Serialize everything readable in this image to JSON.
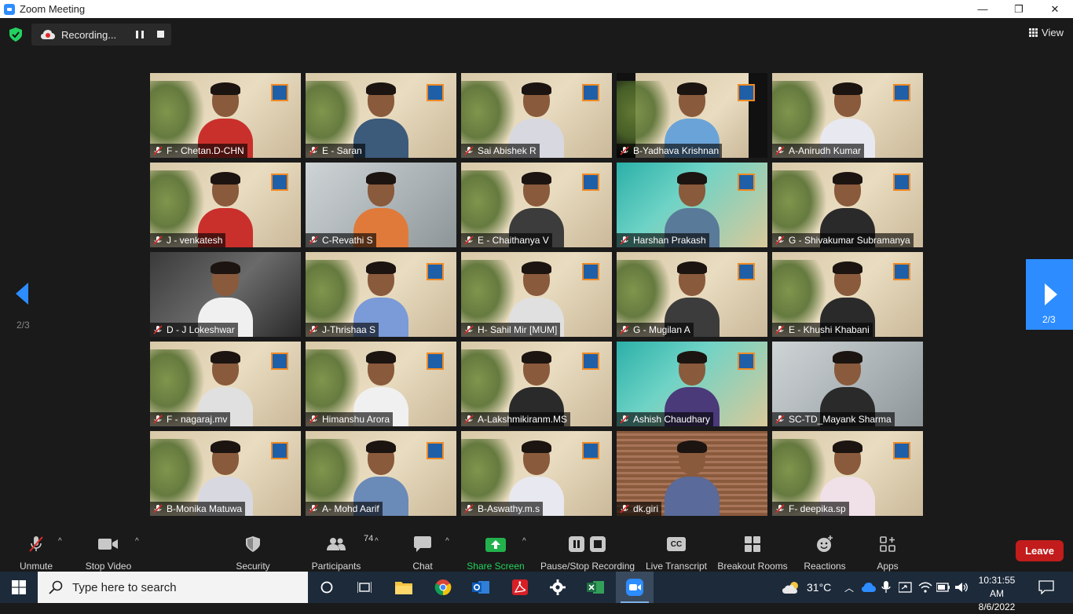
{
  "window": {
    "title": "Zoom Meeting",
    "minimize": "—",
    "maximize": "❐",
    "close": "✕"
  },
  "topbar": {
    "recording_label": "Recording...",
    "view_label": "View"
  },
  "pagination": {
    "left_page": "2/3",
    "right_page": "2/3"
  },
  "participants": [
    {
      "name": "F - Chetan.D-CHN"
    },
    {
      "name": "E - Saran"
    },
    {
      "name": "Sai Abishek R"
    },
    {
      "name": "B-Yadhava Krishnan"
    },
    {
      "name": "A-Anirudh Kumar"
    },
    {
      "name": "J - venkatesh"
    },
    {
      "name": "C-Revathi S"
    },
    {
      "name": "E - Chaithanya V"
    },
    {
      "name": "Harshan Prakash"
    },
    {
      "name": "G - Shivakumar Subramanya"
    },
    {
      "name": "D - J Lokeshwar"
    },
    {
      "name": "J-Thrishaa S"
    },
    {
      "name": "H- Sahil Mir [MUM]"
    },
    {
      "name": "G - Mugilan A"
    },
    {
      "name": "E - Khushi Khabani"
    },
    {
      "name": "F - nagaraj.mv"
    },
    {
      "name": "Himanshu Arora"
    },
    {
      "name": "A-Lakshmikiranm.MS"
    },
    {
      "name": "Ashish Chaudhary"
    },
    {
      "name": "SC-TD_Mayank Sharma"
    },
    {
      "name": "B-Monika Matuwa"
    },
    {
      "name": "A- Mohd Aarif"
    },
    {
      "name": "B-Aswathy.m.s"
    },
    {
      "name": "dk.giri"
    },
    {
      "name": "F- deepika.sp"
    }
  ],
  "toolbar": {
    "unmute": "Unmute",
    "stop_video": "Stop Video",
    "security": "Security",
    "participants_label": "Participants",
    "participants_count": "74",
    "chat": "Chat",
    "share_screen": "Share Screen",
    "pause_stop_recording": "Pause/Stop Recording",
    "live_transcript": "Live Transcript",
    "breakout_rooms": "Breakout Rooms",
    "reactions": "Reactions",
    "apps": "Apps",
    "leave": "Leave",
    "cc": "CC"
  },
  "taskbar": {
    "search_placeholder": "Type here to search",
    "temperature": "31°C",
    "time": "10:31:55 AM",
    "date": "8/6/2022"
  },
  "colors": {
    "accent": "#2d8cff",
    "leave": "#c21c1c",
    "share": "#22b14c",
    "mic_muted": "#e02828"
  }
}
